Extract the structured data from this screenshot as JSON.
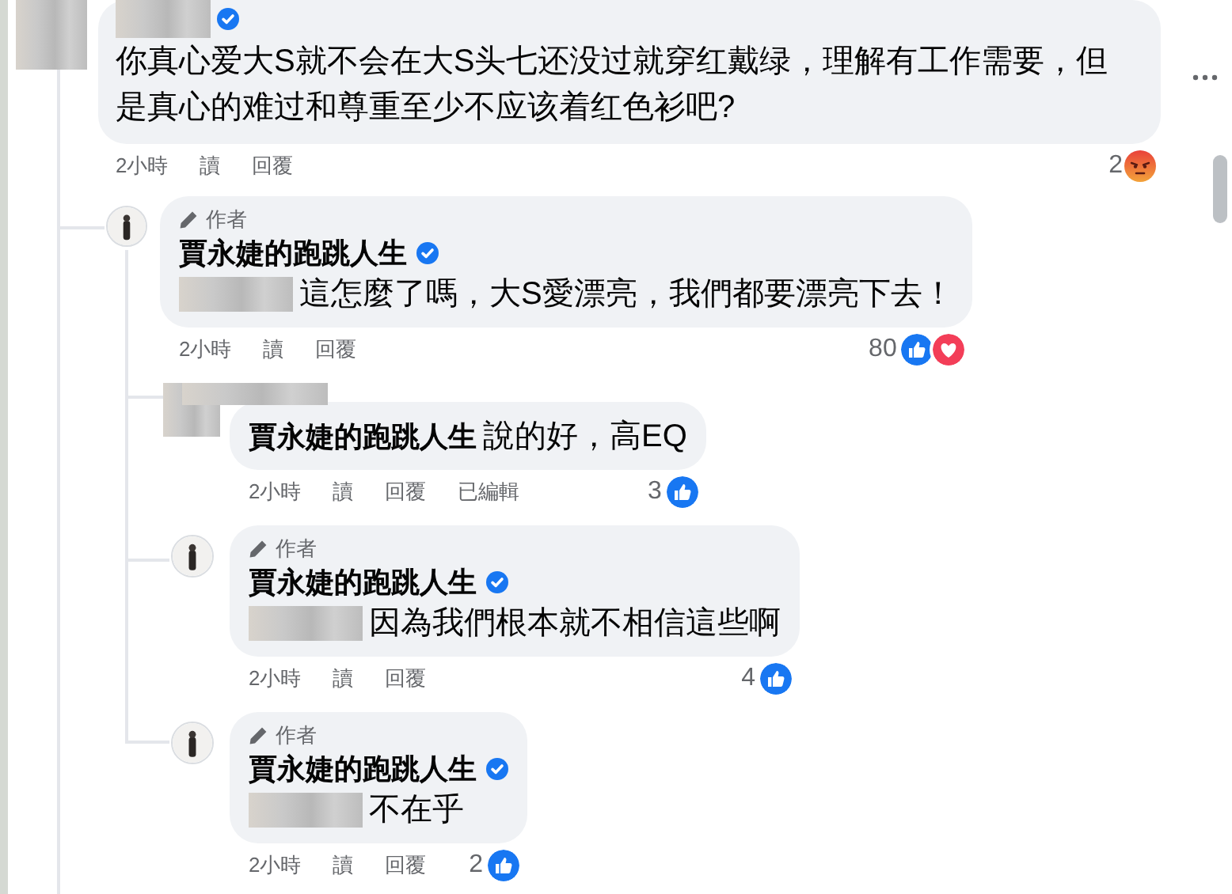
{
  "top_comment": {
    "author_redacted": true,
    "verified": true,
    "text": "你真心爱大S就不会在大S头七还没过就穿红戴绿，理解有工作需要，但是真心的难过和尊重至少不应该着红色衫吧?",
    "time": "2小時",
    "actions": [
      "讀",
      "回覆"
    ],
    "reaction_count": "2",
    "reactions": [
      {
        "kind": "angry"
      }
    ]
  },
  "replies": [
    {
      "author_redacted": false,
      "author_label": "作者",
      "author": "賈永婕的跑跳人生",
      "verified": true,
      "mention_redacted": true,
      "text": "這怎麼了嗎，大S愛漂亮，我們都要漂亮下去！",
      "time": "2小時",
      "actions": [
        "讀",
        "回覆"
      ],
      "reaction_count": "80",
      "reactions": [
        {
          "kind": "like"
        },
        {
          "kind": "love"
        }
      ],
      "children": [
        {
          "author_redacted": true,
          "mention": "賈永婕的跑跳人生",
          "text": "說的好，高EQ",
          "time": "2小時",
          "actions": [
            "讀",
            "回覆",
            "已編輯"
          ],
          "reaction_count": "3",
          "reactions": [
            {
              "kind": "like"
            }
          ]
        },
        {
          "author_redacted": false,
          "author_label": "作者",
          "author": "賈永婕的跑跳人生",
          "verified": true,
          "mention_redacted": true,
          "text": "因為我們根本就不相信這些啊",
          "time": "2小時",
          "actions": [
            "讀",
            "回覆"
          ],
          "reaction_count": "4",
          "reactions": [
            {
              "kind": "like"
            }
          ]
        },
        {
          "author_redacted": false,
          "author_label": "作者",
          "author": "賈永婕的跑跳人生",
          "verified": true,
          "mention_redacted": true,
          "text": "不在乎",
          "time": "2小時",
          "actions": [
            "讀",
            "回覆"
          ],
          "reaction_count": "2",
          "reactions": [
            {
              "kind": "like"
            }
          ]
        }
      ]
    }
  ]
}
